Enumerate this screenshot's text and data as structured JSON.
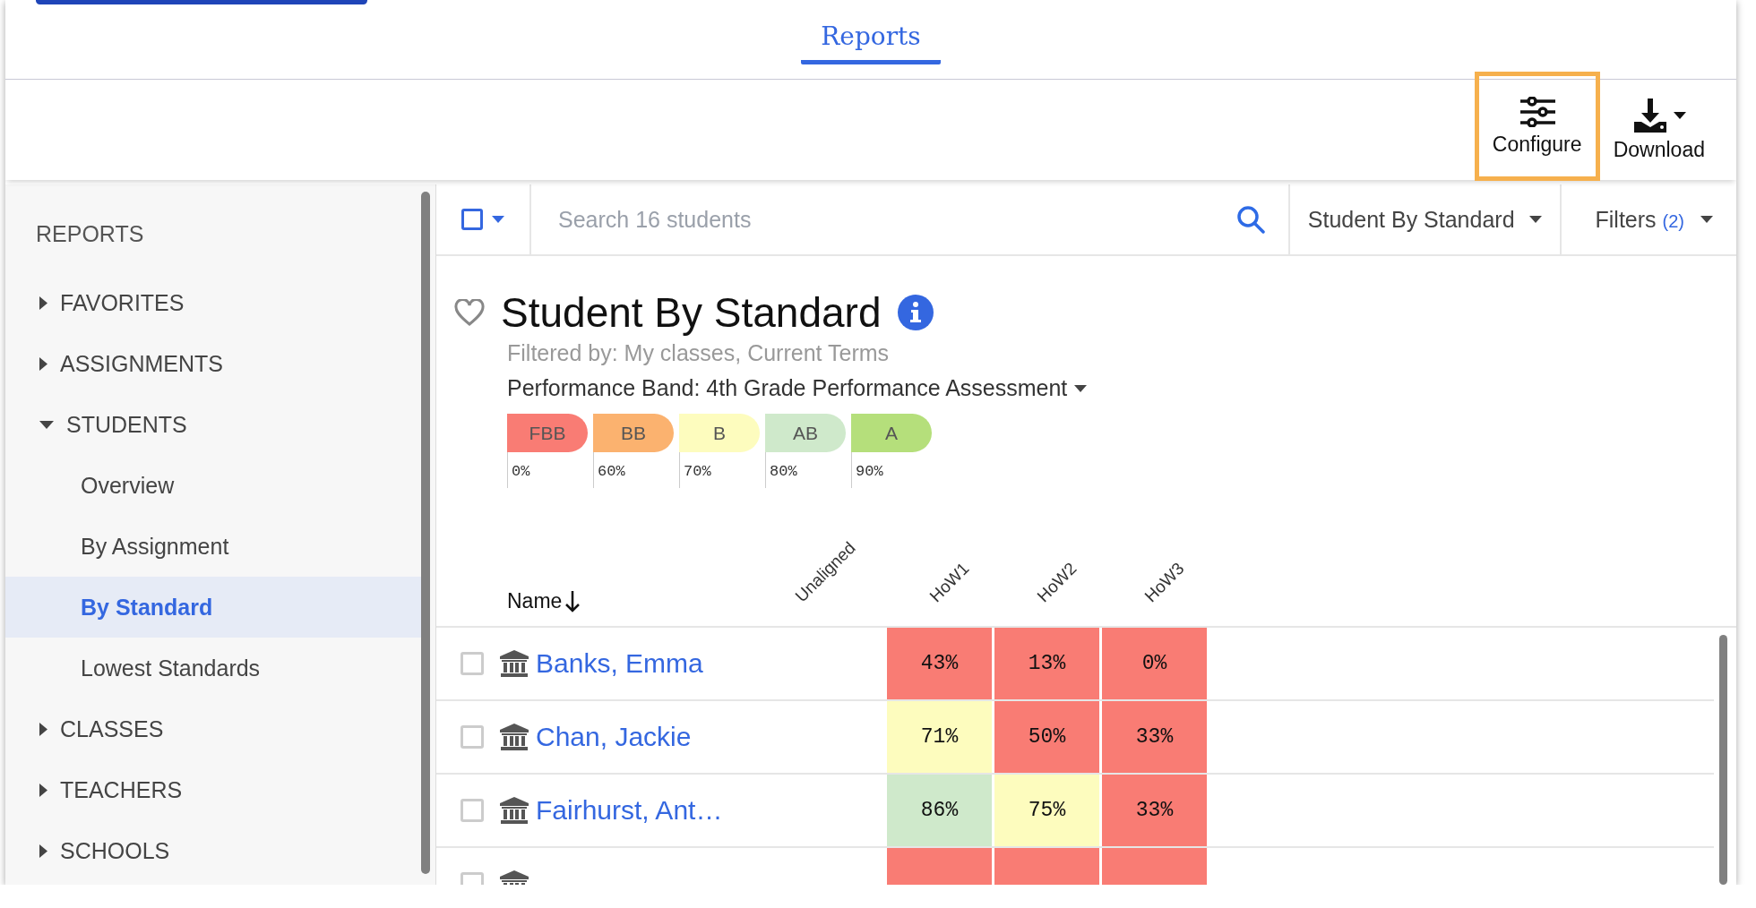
{
  "header": {
    "tabs": [
      {
        "label": "Reports",
        "selected": true
      }
    ]
  },
  "toolbar": {
    "buttons": [
      {
        "kind": "configure",
        "label": "Configure",
        "highlighted": true
      },
      {
        "kind": "download",
        "label": "Download",
        "highlighted": false
      }
    ]
  },
  "sidebar": {
    "heading": "REPORTS",
    "items": [
      {
        "label": "FAVORITES",
        "expanded": false
      },
      {
        "label": "ASSIGNMENTS",
        "expanded": false
      },
      {
        "label": "STUDENTS",
        "expanded": true,
        "children": [
          {
            "label": "Overview",
            "selected": false
          },
          {
            "label": "By Assignment",
            "selected": false
          },
          {
            "label": "By Standard",
            "selected": true
          },
          {
            "label": "Lowest Standards",
            "selected": false
          }
        ]
      },
      {
        "label": "CLASSES",
        "expanded": false
      },
      {
        "label": "TEACHERS",
        "expanded": false
      },
      {
        "label": "SCHOOLS",
        "expanded": false
      }
    ]
  },
  "select_all": {
    "checked": false
  },
  "search": {
    "placeholder": "Search 16 students"
  },
  "view_dropdown": {
    "label": "Student By Standard"
  },
  "filters": {
    "label": "Filters",
    "count": "(2)"
  },
  "report": {
    "title": "Student By Standard",
    "favorite": false,
    "filtered_by": "Filtered by: My classes, Current Terms",
    "band_title": "Performance Band: 4th Grade Performance Assessment"
  },
  "bands": [
    {
      "label": "FBB",
      "threshold": "0%",
      "color": "#f97c74"
    },
    {
      "label": "BB",
      "threshold": "60%",
      "color": "#fbb26f"
    },
    {
      "label": "B",
      "threshold": "70%",
      "color": "#fdfcbe"
    },
    {
      "label": "AB",
      "threshold": "80%",
      "color": "#cfe9cb"
    },
    {
      "label": "A",
      "threshold": "90%",
      "color": "#b5df7b"
    }
  ],
  "table": {
    "name_column": "Name",
    "columns": [
      {
        "label": "Unaligned",
        "kind": "unaligned"
      },
      {
        "label": "HoW1",
        "kind": "standard"
      },
      {
        "label": "HoW2",
        "kind": "standard"
      },
      {
        "label": "HoW3",
        "kind": "standard"
      }
    ],
    "rows": [
      {
        "name": "Banks, Emma",
        "checked": false,
        "scores": [
          {
            "value": "43%",
            "color": "#f97c74"
          },
          {
            "value": "13%",
            "color": "#f97c74"
          },
          {
            "value": "0%",
            "color": "#f97c74"
          }
        ]
      },
      {
        "name": "Chan, Jackie",
        "checked": false,
        "scores": [
          {
            "value": "71%",
            "color": "#fdfcbe"
          },
          {
            "value": "50%",
            "color": "#f97c74"
          },
          {
            "value": "33%",
            "color": "#f97c74"
          }
        ]
      },
      {
        "name": "Fairhurst, Ant…",
        "checked": false,
        "scores": [
          {
            "value": "86%",
            "color": "#cfe9cb"
          },
          {
            "value": "75%",
            "color": "#fdfcbe"
          },
          {
            "value": "33%",
            "color": "#f97c74"
          }
        ]
      },
      {
        "checked": false,
        "scores": [
          {
            "color": "#f97c74"
          },
          {
            "color": "#f97c74"
          },
          {
            "color": "#f97c74"
          }
        ]
      }
    ]
  }
}
